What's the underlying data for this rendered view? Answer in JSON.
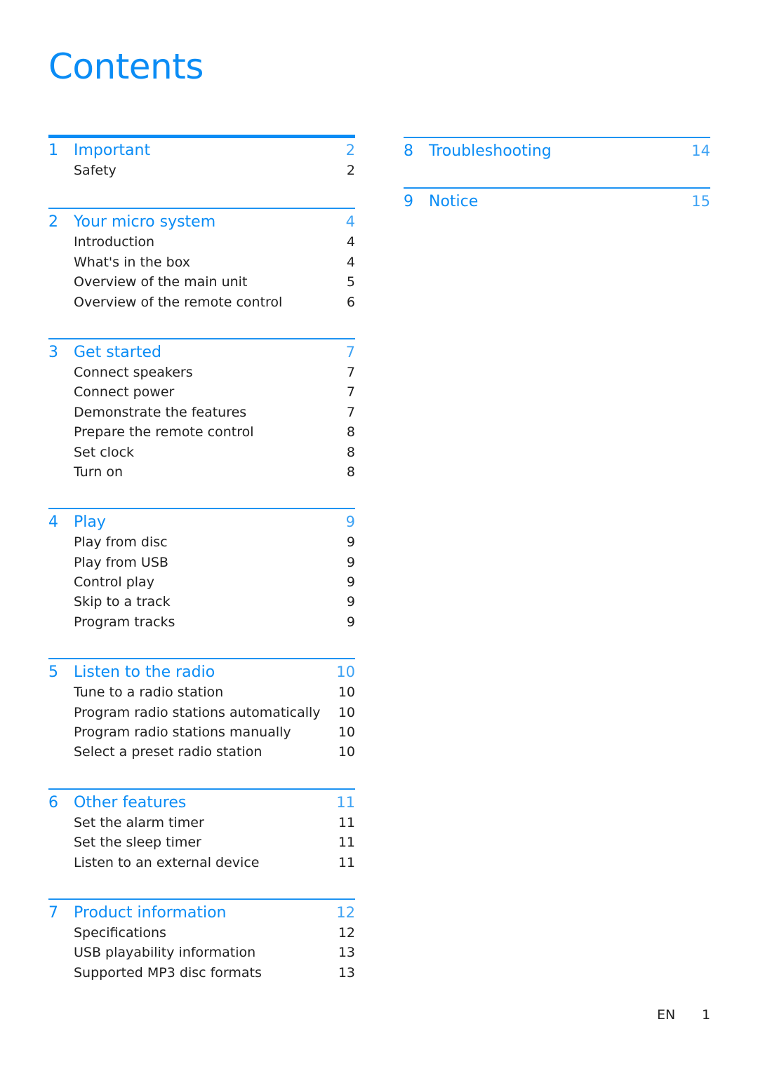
{
  "page_title": "Contents",
  "accent_color": "#0a8cf5",
  "left_column": [
    {
      "num": "1",
      "title": "Important",
      "page": "2",
      "entries": [
        {
          "title": "Safety",
          "page": "2"
        }
      ]
    },
    {
      "num": "2",
      "title": "Your micro system",
      "page": "4",
      "entries": [
        {
          "title": "Introduction",
          "page": "4"
        },
        {
          "title": "What's in the box",
          "page": "4"
        },
        {
          "title": "Overview of the main unit",
          "page": "5"
        },
        {
          "title": "Overview of the remote control",
          "page": "6"
        }
      ]
    },
    {
      "num": "3",
      "title": "Get started",
      "page": "7",
      "entries": [
        {
          "title": "Connect speakers",
          "page": "7"
        },
        {
          "title": "Connect power",
          "page": "7"
        },
        {
          "title": "Demonstrate the features",
          "page": "7"
        },
        {
          "title": "Prepare the remote control",
          "page": "8"
        },
        {
          "title": "Set clock",
          "page": "8"
        },
        {
          "title": "Turn on",
          "page": "8"
        }
      ]
    },
    {
      "num": "4",
      "title": "Play",
      "page": "9",
      "entries": [
        {
          "title": "Play from disc",
          "page": "9"
        },
        {
          "title": "Play from USB",
          "page": "9"
        },
        {
          "title": "Control play",
          "page": "9"
        },
        {
          "title": "Skip to a track",
          "page": "9"
        },
        {
          "title": "Program tracks",
          "page": "9"
        }
      ]
    },
    {
      "num": "5",
      "title": "Listen to the radio",
      "page": "10",
      "entries": [
        {
          "title": "Tune to a radio station",
          "page": "10"
        },
        {
          "title": "Program radio stations automatically",
          "page": "10"
        },
        {
          "title": "Program radio stations manually",
          "page": "10"
        },
        {
          "title": "Select a preset radio station",
          "page": "10"
        }
      ]
    },
    {
      "num": "6",
      "title": "Other features",
      "page": "11",
      "entries": [
        {
          "title": "Set the alarm timer",
          "page": "11"
        },
        {
          "title": "Set the sleep timer",
          "page": "11"
        },
        {
          "title": "Listen to an external device",
          "page": "11"
        }
      ]
    },
    {
      "num": "7",
      "title": "Product information",
      "page": "12",
      "entries": [
        {
          "title": "Specifications",
          "page": "12"
        },
        {
          "title": "USB playability information",
          "page": "13"
        },
        {
          "title": "Supported MP3 disc formats",
          "page": "13"
        }
      ]
    }
  ],
  "right_column": [
    {
      "num": "8",
      "title": "Troubleshooting",
      "page": "14",
      "entries": []
    },
    {
      "num": "9",
      "title": "Notice",
      "page": "15",
      "entries": []
    }
  ],
  "footer": {
    "language": "EN",
    "page_number": "1"
  }
}
